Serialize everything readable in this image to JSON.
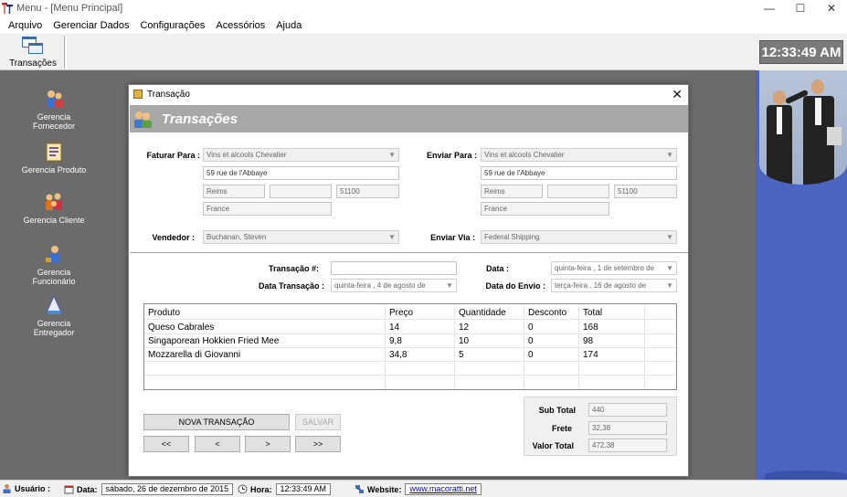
{
  "window": {
    "title": "Menu - [Menu Principal]",
    "controls": [
      "—",
      "☐",
      "✕"
    ]
  },
  "menu": [
    "Arquivo",
    "Gerenciar Dados",
    "Configurações",
    "Acessórios",
    "Ajuda"
  ],
  "toolbar": {
    "transacoes_label": "Transações"
  },
  "clock": "12:33:49 AM",
  "sidebar": [
    {
      "label": "Gerencia Fornecedor",
      "icon": "supplier-icon"
    },
    {
      "label": "Gerencia Produto",
      "icon": "product-icon"
    },
    {
      "label": "Gerencia Cliente",
      "icon": "client-icon"
    },
    {
      "label": "Gerencia Funcionário",
      "icon": "employee-icon"
    },
    {
      "label": "Gerencia Entregador",
      "icon": "shipper-icon"
    }
  ],
  "dialog": {
    "title": "Transação",
    "header": "Transações",
    "faturar": {
      "label": "Faturar Para :",
      "name": "Vins et alcools Chevalier",
      "address": "59 rue de l'Abbaye",
      "city": "Reims",
      "region": "",
      "postal": "51100",
      "country": "France"
    },
    "enviar": {
      "label": "Enviar Para :",
      "name": "Vins et alcools Chevalier",
      "address": "59 rue de l'Abbaye",
      "city": "Reims",
      "region": "",
      "postal": "51100",
      "country": "France"
    },
    "vendedor": {
      "label": "Vendedor :",
      "value": "Buchanan, Steven"
    },
    "enviar_via": {
      "label": "Enviar Via :",
      "value": "Federal Shipping"
    },
    "transacao_num": {
      "label": "Transação #:",
      "value": ""
    },
    "data": {
      "label": "Data :",
      "weekday": "quinta-feira",
      "day": "1",
      "month_year": "de setembro de"
    },
    "data_transacao": {
      "label": "Data Transação :",
      "weekday": "quinta-feira",
      "day": "4",
      "month_year": "de  agosto  de"
    },
    "data_envio": {
      "label": "Data do Envio :",
      "weekday": "terça-feira",
      "day": "16",
      "month_year": "de  agosto  de"
    },
    "grid": {
      "columns": [
        "Produto",
        "Preço",
        "Quantidade",
        "Desconto",
        "Total"
      ],
      "rows": [
        [
          "Queso Cabrales",
          "14",
          "12",
          "0",
          "168"
        ],
        [
          "Singaporean Hokkien Fried Mee",
          "9,8",
          "10",
          "0",
          "98"
        ],
        [
          "Mozzarella di Giovanni",
          "34,8",
          "5",
          "0",
          "174"
        ]
      ]
    },
    "totals": {
      "subtotal_label": "Sub Total",
      "subtotal": "440",
      "frete_label": "Frete",
      "frete": "32,38",
      "valor_label": "Valor Total",
      "valor": "472,38"
    },
    "buttons": {
      "nova": "NOVA TRANSAÇÃO",
      "salvar": "SALVAR",
      "first": "<<",
      "prev": "<",
      "next": ">",
      "last": ">>"
    }
  },
  "status": {
    "usuario_label": "Usuário :",
    "data_label": "Data:",
    "data_value": "sábado, 26 de dezembro de 2015",
    "hora_label": "Hora:",
    "hora_value": "12:33:49 AM",
    "website_label": "Website:",
    "website_value": "www.macoratti.net"
  }
}
